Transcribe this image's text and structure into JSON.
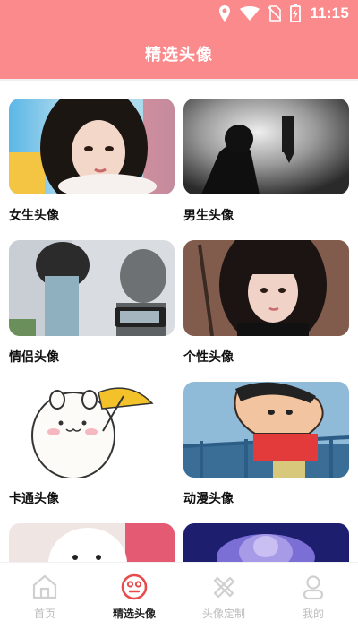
{
  "status": {
    "time": "11:15"
  },
  "header": {
    "title": "精选头像"
  },
  "grid": {
    "items": [
      {
        "label": "女生头像"
      },
      {
        "label": "男生头像"
      },
      {
        "label": "情侣头像"
      },
      {
        "label": "个性头像"
      },
      {
        "label": "卡通头像"
      },
      {
        "label": "动漫头像"
      },
      {
        "label": ""
      },
      {
        "label": ""
      }
    ]
  },
  "nav": {
    "items": [
      {
        "label": "首页",
        "icon": "home-icon"
      },
      {
        "label": "精选头像",
        "icon": "face-icon",
        "active": true
      },
      {
        "label": "头像定制",
        "icon": "tools-icon"
      },
      {
        "label": "我的",
        "icon": "profile-icon"
      }
    ]
  },
  "colors": {
    "accent": "#fa8a8b",
    "active": "#e84b4b"
  }
}
